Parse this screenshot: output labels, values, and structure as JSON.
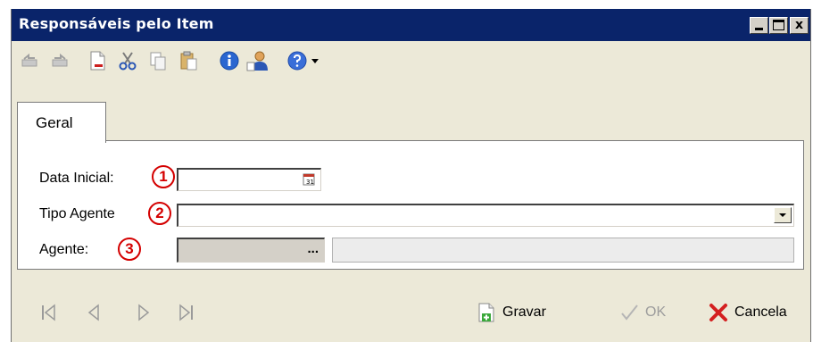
{
  "window": {
    "title": "Responsáveis pelo Item",
    "controls": {
      "minimize": "_",
      "maximize": "□",
      "close": "x"
    }
  },
  "toolbar": {
    "buttons": [
      {
        "name": "undo-icon"
      },
      {
        "name": "redo-icon"
      },
      {
        "name": "new-document-icon"
      },
      {
        "name": "cut-icon"
      },
      {
        "name": "copy-icon"
      },
      {
        "name": "paste-icon"
      },
      {
        "name": "info-icon"
      },
      {
        "name": "user-icon"
      },
      {
        "name": "help-icon"
      },
      {
        "name": "dropdown-arrow-icon"
      }
    ]
  },
  "tabs": [
    {
      "label": "Geral",
      "active": true
    }
  ],
  "form": {
    "data_inicial": {
      "label": "Data Inicial:",
      "marker": "1",
      "value": ""
    },
    "tipo_agente": {
      "label": "Tipo Agente",
      "marker": "2",
      "value": ""
    },
    "agente": {
      "label": "Agente:",
      "marker": "3",
      "button": "...",
      "code": "",
      "name": ""
    }
  },
  "footer": {
    "nav": [
      "first-record-icon",
      "previous-record-icon",
      "next-record-icon",
      "last-record-icon"
    ],
    "gravar": "Gravar",
    "ok": "OK",
    "cancela": "Cancela"
  },
  "colors": {
    "titlebar": "#0a246a",
    "window_bg": "#ece9d8",
    "marker_red": "#d40000",
    "disabled_field": "#d4d0c8"
  }
}
